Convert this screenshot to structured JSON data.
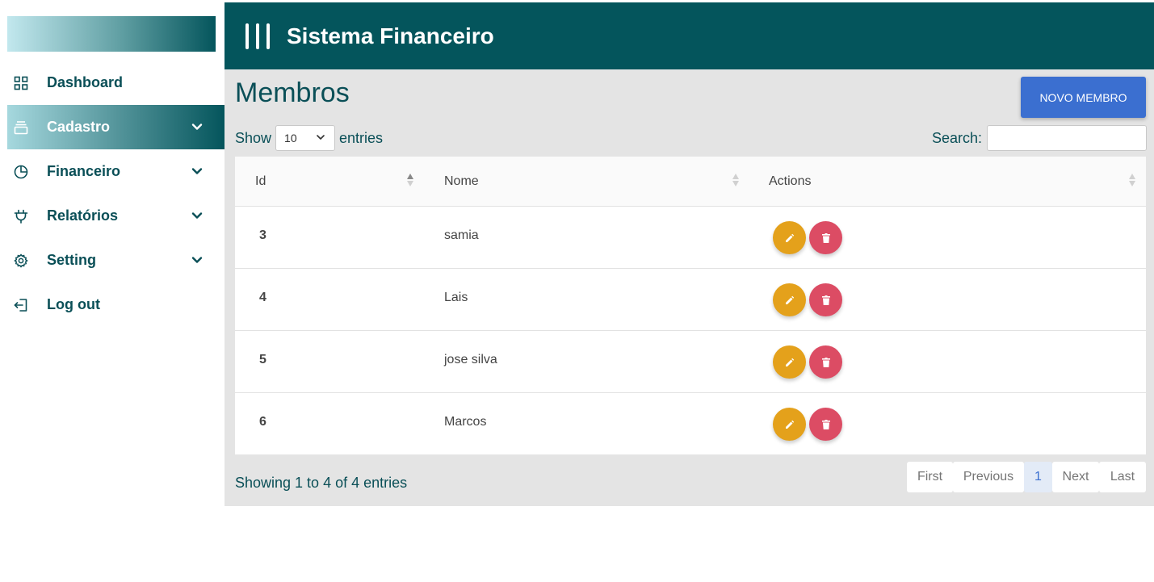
{
  "app": {
    "title": "Sistema Financeiro"
  },
  "sidebar": {
    "items": [
      {
        "label": "Dashboard",
        "icon": "grid-icon",
        "active": false,
        "has_children": false
      },
      {
        "label": "Cadastro",
        "icon": "archive-icon",
        "active": true,
        "has_children": true
      },
      {
        "label": "Financeiro",
        "icon": "pie-chart-icon",
        "active": false,
        "has_children": true
      },
      {
        "label": "Relatórios",
        "icon": "plug-icon",
        "active": false,
        "has_children": true
      },
      {
        "label": "Setting",
        "icon": "gear-icon",
        "active": false,
        "has_children": true
      },
      {
        "label": "Log out",
        "icon": "logout-icon",
        "active": false,
        "has_children": false
      }
    ]
  },
  "page": {
    "title": "Membros",
    "new_button": "NOVO MEMBRO"
  },
  "table_controls": {
    "show_label": "Show",
    "page_length": "10",
    "entries_label": "entries",
    "search_label": "Search:",
    "search_value": ""
  },
  "table": {
    "columns": [
      "Id",
      "Nome",
      "Actions"
    ],
    "rows": [
      {
        "id": "3",
        "nome": "samia"
      },
      {
        "id": "4",
        "nome": "Lais"
      },
      {
        "id": "5",
        "nome": "jose silva"
      },
      {
        "id": "6",
        "nome": "Marcos"
      }
    ]
  },
  "footer": {
    "info": "Showing 1 to 4 of 4 entries",
    "pagination": {
      "first": "First",
      "previous": "Previous",
      "current": "1",
      "next": "Next",
      "last": "Last"
    }
  },
  "colors": {
    "header": "#04555c",
    "primary_button": "#3b6fd0",
    "edit_button": "#e4a11b",
    "delete_button": "#dc4c64",
    "text_accent": "#0a4f57"
  }
}
